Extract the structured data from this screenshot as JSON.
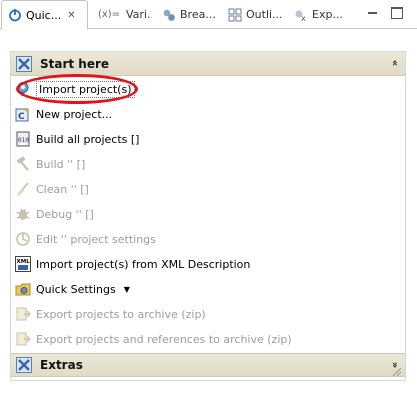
{
  "tabs": [
    {
      "label": "Quic...",
      "close": "✕",
      "icon": "quick-launch-icon",
      "active": true
    },
    {
      "label": "Vari...",
      "icon": "variables-icon",
      "prefix": "(x)="
    },
    {
      "label": "Brea...",
      "icon": "breakpoints-icon"
    },
    {
      "label": "Outli...",
      "icon": "outline-icon"
    },
    {
      "label": "Exp...",
      "icon": "expressions-icon"
    }
  ],
  "sections": {
    "start": {
      "title": "Start here",
      "collapse_glyph": "«"
    },
    "extras": {
      "title": "Extras",
      "expand_glyph": "»"
    }
  },
  "items": [
    {
      "label": "Import project(s)",
      "icon": "import-project-icon",
      "enabled": true
    },
    {
      "label": "New project...",
      "icon": "new-project-icon",
      "enabled": true
    },
    {
      "label": "Build all projects []",
      "icon": "build-all-icon",
      "enabled": true
    },
    {
      "label": "Build '' []",
      "icon": "build-hammer-icon",
      "enabled": false
    },
    {
      "label": "Clean '' []",
      "icon": "clean-broom-icon",
      "enabled": false
    },
    {
      "label": "Debug '' []",
      "icon": "debug-icon",
      "enabled": false
    },
    {
      "label": "Edit '' project settings",
      "icon": "project-settings-icon",
      "enabled": false
    },
    {
      "label": "Import project(s) from XML Description",
      "icon": "xml-import-icon",
      "enabled": true
    },
    {
      "label": "Quick Settings",
      "icon": "quick-settings-icon",
      "enabled": true,
      "dropdown": "▼"
    },
    {
      "label": "Export projects to archive (zip)",
      "icon": "export-archive-icon",
      "enabled": false
    },
    {
      "label": "Export projects and references to archive (zip)",
      "icon": "export-references-icon",
      "enabled": false
    }
  ],
  "colors": {
    "highlight_ring": "#e0141a",
    "section_header": "#e6e1cd",
    "disabled_text": "#9d9d9d"
  }
}
